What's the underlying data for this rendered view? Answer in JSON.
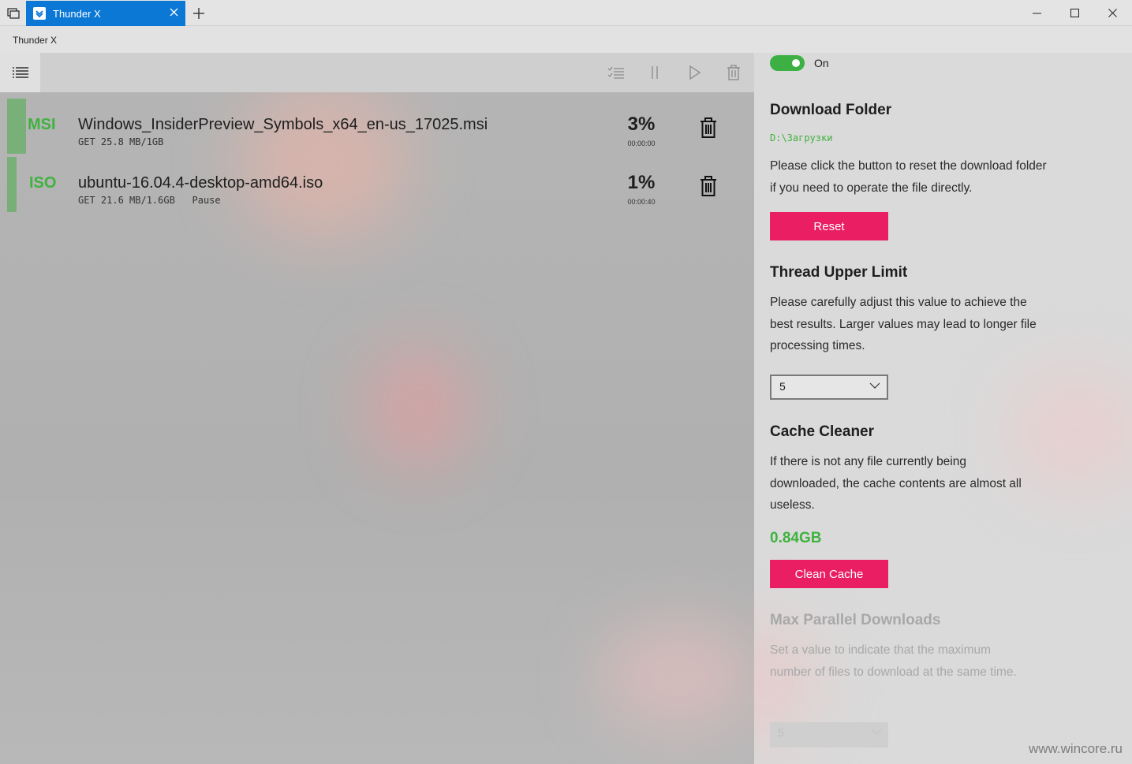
{
  "window": {
    "tab_title": "Thunder X",
    "app_title": "Thunder X"
  },
  "downloads": [
    {
      "ext": "MSI",
      "filename": "Windows_InsiderPreview_Symbols_x64_en-us_17025.msi",
      "meta": "GET 25.8 MB/1GB",
      "percent": "3%",
      "eta": "00:00:00"
    },
    {
      "ext": "ISO",
      "filename": "ubuntu-16.04.4-desktop-amd64.iso",
      "meta": "GET 21.6 MB/1.6GB   Pause",
      "percent": "1%",
      "eta": "00:00:40"
    }
  ],
  "settings": {
    "toggle_label": "On",
    "download_folder": {
      "heading": "Download Folder",
      "path": "D:\\Загрузки",
      "description": "Please click the button to reset the download folder if you need to operate the file directly.",
      "button": "Reset"
    },
    "thread_limit": {
      "heading": "Thread Upper Limit",
      "description": "Please carefully adjust this value to achieve the best results. Larger values may lead to longer file processing times.",
      "value": "5"
    },
    "cache_cleaner": {
      "heading": "Cache Cleaner",
      "description": "If there is not any file currently being downloaded, the cache contents are almost all useless.",
      "size": "0.84GB",
      "button": "Clean Cache"
    },
    "max_parallel": {
      "heading": "Max Parallel Downloads",
      "description": "Set a value to indicate that the maximum number of files to download at the same time.",
      "value": "5"
    }
  },
  "watermark": "www.wincore.ru",
  "colors": {
    "accent": "#e91e63",
    "success": "#3fb23f",
    "tab_active": "#0b78d6"
  }
}
